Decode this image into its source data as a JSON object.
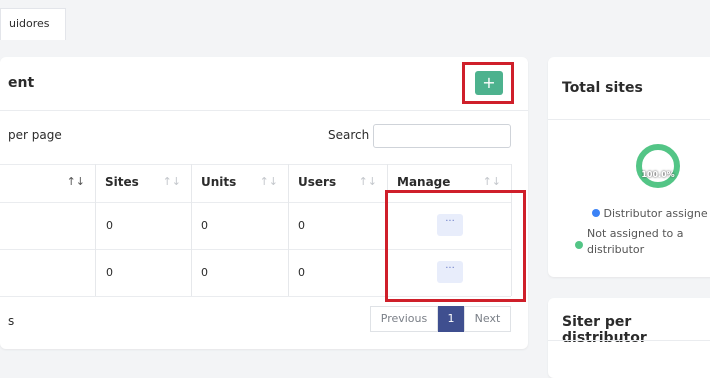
{
  "tab": {
    "label": "uidores"
  },
  "main": {
    "title": "ent",
    "add_label": "+",
    "per_page": "per page",
    "search_label": "Search",
    "search_value": "",
    "columns": [
      {
        "label": "",
        "sort": "↑↓"
      },
      {
        "label": "Sites",
        "sort": "↑↓"
      },
      {
        "label": "Units",
        "sort": "↑↓"
      },
      {
        "label": "Users",
        "sort": "↑↓"
      },
      {
        "label": "Manage",
        "sort": "↑↓"
      }
    ],
    "rows": [
      {
        "sites": "0",
        "units": "0",
        "users": "0",
        "manage": "···"
      },
      {
        "sites": "0",
        "units": "0",
        "users": "0",
        "manage": "···"
      }
    ],
    "footer_info": "s",
    "pagination": {
      "previous": "Previous",
      "current": "1",
      "next": "Next"
    }
  },
  "total_sites": {
    "title": "Total sites",
    "donut_label": "100.0%",
    "legend": [
      {
        "label": "Distributor assigne",
        "color": "#3b82f6"
      },
      {
        "label": "Not assigned to a distributor",
        "color": "#53c586"
      }
    ]
  },
  "siter": {
    "title": "Siter per distributor"
  },
  "colors": {
    "accent": "#4db28e",
    "highlight": "#cf1f2a",
    "pager_active": "#3f4f8f"
  }
}
